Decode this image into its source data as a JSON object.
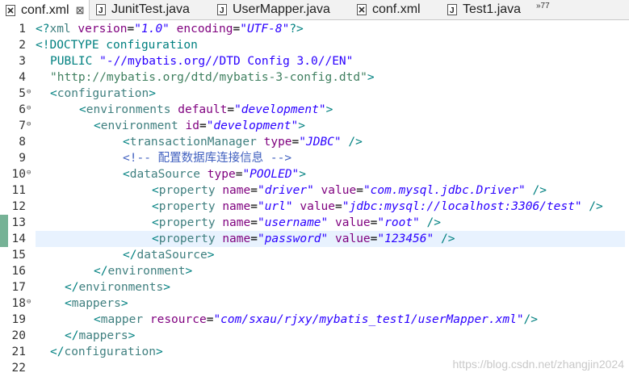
{
  "tabs": [
    {
      "label": "conf.xml",
      "icon": "xml-file-icon",
      "active": true
    },
    {
      "label": "JunitTest.java",
      "icon": "java-file-icon",
      "active": false
    },
    {
      "label": "UserMapper.java",
      "icon": "java-file-icon",
      "active": false
    },
    {
      "label": "conf.xml",
      "icon": "xml-file-icon",
      "active": false
    },
    {
      "label": "Test1.java",
      "icon": "java-file-icon",
      "active": false
    }
  ],
  "overflow_label": "»77",
  "close_glyph": "⊠",
  "current_line": 14,
  "changed_lines": [
    13,
    14
  ],
  "lines": [
    {
      "n": "1",
      "fold": "",
      "indent": 0,
      "tokens": [
        {
          "c": "t-br",
          "t": "<?"
        },
        {
          "c": "t-tag",
          "t": "xml"
        },
        {
          "c": "t-text",
          "t": " "
        },
        {
          "c": "t-attr",
          "t": "version"
        },
        {
          "c": "t-text",
          "t": "="
        },
        {
          "c": "t-val",
          "t": "\"1.0\""
        },
        {
          "c": "t-text",
          "t": " "
        },
        {
          "c": "t-attr",
          "t": "encoding"
        },
        {
          "c": "t-text",
          "t": "="
        },
        {
          "c": "t-val",
          "t": "\"UTF-8\""
        },
        {
          "c": "t-br",
          "t": "?>"
        }
      ]
    },
    {
      "n": "2",
      "fold": "",
      "indent": 0,
      "tokens": [
        {
          "c": "t-br",
          "t": "<!"
        },
        {
          "c": "t-doctype-kw",
          "t": "DOCTYPE configuration"
        }
      ]
    },
    {
      "n": "3",
      "fold": "",
      "indent": 1,
      "tokens": [
        {
          "c": "t-doctype-kw",
          "t": "PUBLIC "
        },
        {
          "c": "t-doctype-str2",
          "t": "\"-//mybatis.org//DTD Config 3.0//EN\""
        }
      ]
    },
    {
      "n": "4",
      "fold": "",
      "indent": 1,
      "tokens": [
        {
          "c": "t-doctype-str",
          "t": "\"http://mybatis.org/dtd/mybatis-3-config.dtd\""
        },
        {
          "c": "t-br",
          "t": ">"
        }
      ]
    },
    {
      "n": "5",
      "fold": "⊖",
      "indent": 1,
      "tokens": [
        {
          "c": "t-br",
          "t": "<"
        },
        {
          "c": "t-tag",
          "t": "configuration"
        },
        {
          "c": "t-br",
          "t": ">"
        }
      ]
    },
    {
      "n": "6",
      "fold": "⊖",
      "indent": 3,
      "tokens": [
        {
          "c": "t-br",
          "t": "<"
        },
        {
          "c": "t-tag",
          "t": "environments"
        },
        {
          "c": "t-text",
          "t": " "
        },
        {
          "c": "t-attr",
          "t": "default"
        },
        {
          "c": "t-text",
          "t": "="
        },
        {
          "c": "t-val",
          "t": "\"development\""
        },
        {
          "c": "t-br",
          "t": ">"
        }
      ]
    },
    {
      "n": "7",
      "fold": "⊖",
      "indent": 4,
      "tokens": [
        {
          "c": "t-br",
          "t": "<"
        },
        {
          "c": "t-tag",
          "t": "environment"
        },
        {
          "c": "t-text",
          "t": " "
        },
        {
          "c": "t-attr",
          "t": "id"
        },
        {
          "c": "t-text",
          "t": "="
        },
        {
          "c": "t-val",
          "t": "\"development\""
        },
        {
          "c": "t-br",
          "t": ">"
        }
      ]
    },
    {
      "n": "8",
      "fold": "",
      "indent": 6,
      "tokens": [
        {
          "c": "t-br",
          "t": "<"
        },
        {
          "c": "t-tag",
          "t": "transactionManager"
        },
        {
          "c": "t-text",
          "t": " "
        },
        {
          "c": "t-attr",
          "t": "type"
        },
        {
          "c": "t-text",
          "t": "="
        },
        {
          "c": "t-val",
          "t": "\"JDBC\""
        },
        {
          "c": "t-text",
          "t": " "
        },
        {
          "c": "t-br",
          "t": "/>"
        }
      ]
    },
    {
      "n": "9",
      "fold": "",
      "indent": 6,
      "tokens": [
        {
          "c": "t-comment",
          "t": "<!-- 配置数据库连接信息 -->"
        }
      ]
    },
    {
      "n": "10",
      "fold": "⊖",
      "indent": 6,
      "tokens": [
        {
          "c": "t-br",
          "t": "<"
        },
        {
          "c": "t-tag",
          "t": "dataSource"
        },
        {
          "c": "t-text",
          "t": " "
        },
        {
          "c": "t-attr",
          "t": "type"
        },
        {
          "c": "t-text",
          "t": "="
        },
        {
          "c": "t-val",
          "t": "\"POOLED\""
        },
        {
          "c": "t-br",
          "t": ">"
        }
      ]
    },
    {
      "n": "11",
      "fold": "",
      "indent": 8,
      "tokens": [
        {
          "c": "t-br",
          "t": "<"
        },
        {
          "c": "t-tag",
          "t": "property"
        },
        {
          "c": "t-text",
          "t": " "
        },
        {
          "c": "t-attr",
          "t": "name"
        },
        {
          "c": "t-text",
          "t": "="
        },
        {
          "c": "t-val",
          "t": "\"driver\""
        },
        {
          "c": "t-text",
          "t": " "
        },
        {
          "c": "t-attr",
          "t": "value"
        },
        {
          "c": "t-text",
          "t": "="
        },
        {
          "c": "t-val",
          "t": "\"com.mysql.jdbc.Driver\""
        },
        {
          "c": "t-text",
          "t": " "
        },
        {
          "c": "t-br",
          "t": "/>"
        }
      ]
    },
    {
      "n": "12",
      "fold": "",
      "indent": 8,
      "tokens": [
        {
          "c": "t-br",
          "t": "<"
        },
        {
          "c": "t-tag",
          "t": "property"
        },
        {
          "c": "t-text",
          "t": " "
        },
        {
          "c": "t-attr",
          "t": "name"
        },
        {
          "c": "t-text",
          "t": "="
        },
        {
          "c": "t-val",
          "t": "\"url\""
        },
        {
          "c": "t-text",
          "t": " "
        },
        {
          "c": "t-attr",
          "t": "value"
        },
        {
          "c": "t-text",
          "t": "="
        },
        {
          "c": "t-val",
          "t": "\"jdbc:mysql://localhost:3306/test\""
        },
        {
          "c": "t-text",
          "t": " "
        },
        {
          "c": "t-br",
          "t": "/>"
        }
      ]
    },
    {
      "n": "13",
      "fold": "",
      "indent": 8,
      "tokens": [
        {
          "c": "t-br",
          "t": "<"
        },
        {
          "c": "t-tag",
          "t": "property"
        },
        {
          "c": "t-text",
          "t": " "
        },
        {
          "c": "t-attr",
          "t": "name"
        },
        {
          "c": "t-text",
          "t": "="
        },
        {
          "c": "t-val",
          "t": "\"username\""
        },
        {
          "c": "t-text",
          "t": " "
        },
        {
          "c": "t-attr",
          "t": "value"
        },
        {
          "c": "t-text",
          "t": "="
        },
        {
          "c": "t-val",
          "t": "\"root\""
        },
        {
          "c": "t-text",
          "t": " "
        },
        {
          "c": "t-br",
          "t": "/>"
        }
      ]
    },
    {
      "n": "14",
      "fold": "",
      "indent": 8,
      "tokens": [
        {
          "c": "t-br",
          "t": "<"
        },
        {
          "c": "t-tag",
          "t": "property"
        },
        {
          "c": "t-text",
          "t": " "
        },
        {
          "c": "t-attr",
          "t": "name"
        },
        {
          "c": "t-text",
          "t": "="
        },
        {
          "c": "t-val",
          "t": "\"password\""
        },
        {
          "c": "t-text",
          "t": " "
        },
        {
          "c": "t-attr",
          "t": "value"
        },
        {
          "c": "t-text",
          "t": "="
        },
        {
          "c": "t-val",
          "t": "\"123456\""
        },
        {
          "c": "t-text",
          "t": " "
        },
        {
          "c": "t-br",
          "t": "/>"
        }
      ]
    },
    {
      "n": "15",
      "fold": "",
      "indent": 6,
      "tokens": [
        {
          "c": "t-br",
          "t": "</"
        },
        {
          "c": "t-tag",
          "t": "dataSource"
        },
        {
          "c": "t-br",
          "t": ">"
        }
      ]
    },
    {
      "n": "16",
      "fold": "",
      "indent": 4,
      "tokens": [
        {
          "c": "t-br",
          "t": "</"
        },
        {
          "c": "t-tag",
          "t": "environment"
        },
        {
          "c": "t-br",
          "t": ">"
        }
      ]
    },
    {
      "n": "17",
      "fold": "",
      "indent": 2,
      "tokens": [
        {
          "c": "t-br",
          "t": "</"
        },
        {
          "c": "t-tag",
          "t": "environments"
        },
        {
          "c": "t-br",
          "t": ">"
        }
      ]
    },
    {
      "n": "18",
      "fold": "⊖",
      "indent": 2,
      "tokens": [
        {
          "c": "t-br",
          "t": "<"
        },
        {
          "c": "t-tag",
          "t": "mappers"
        },
        {
          "c": "t-br",
          "t": ">"
        }
      ]
    },
    {
      "n": "19",
      "fold": "",
      "indent": 4,
      "tokens": [
        {
          "c": "t-br",
          "t": "<"
        },
        {
          "c": "t-tag",
          "t": "mapper"
        },
        {
          "c": "t-text",
          "t": " "
        },
        {
          "c": "t-attr",
          "t": "resource"
        },
        {
          "c": "t-text",
          "t": "="
        },
        {
          "c": "t-val",
          "t": "\"com/sxau/rjxy/mybatis_test1/userMapper.xml\""
        },
        {
          "c": "t-br",
          "t": "/>"
        }
      ]
    },
    {
      "n": "20",
      "fold": "",
      "indent": 2,
      "tokens": [
        {
          "c": "t-br",
          "t": "</"
        },
        {
          "c": "t-tag",
          "t": "mappers"
        },
        {
          "c": "t-br",
          "t": ">"
        }
      ]
    },
    {
      "n": "21",
      "fold": "",
      "indent": 1,
      "tokens": [
        {
          "c": "t-br",
          "t": "</"
        },
        {
          "c": "t-tag",
          "t": "configuration"
        },
        {
          "c": "t-br",
          "t": ">"
        }
      ]
    },
    {
      "n": "22",
      "fold": "",
      "indent": 0,
      "tokens": []
    }
  ],
  "watermark": "https://blog.csdn.net/zhangjin2024"
}
